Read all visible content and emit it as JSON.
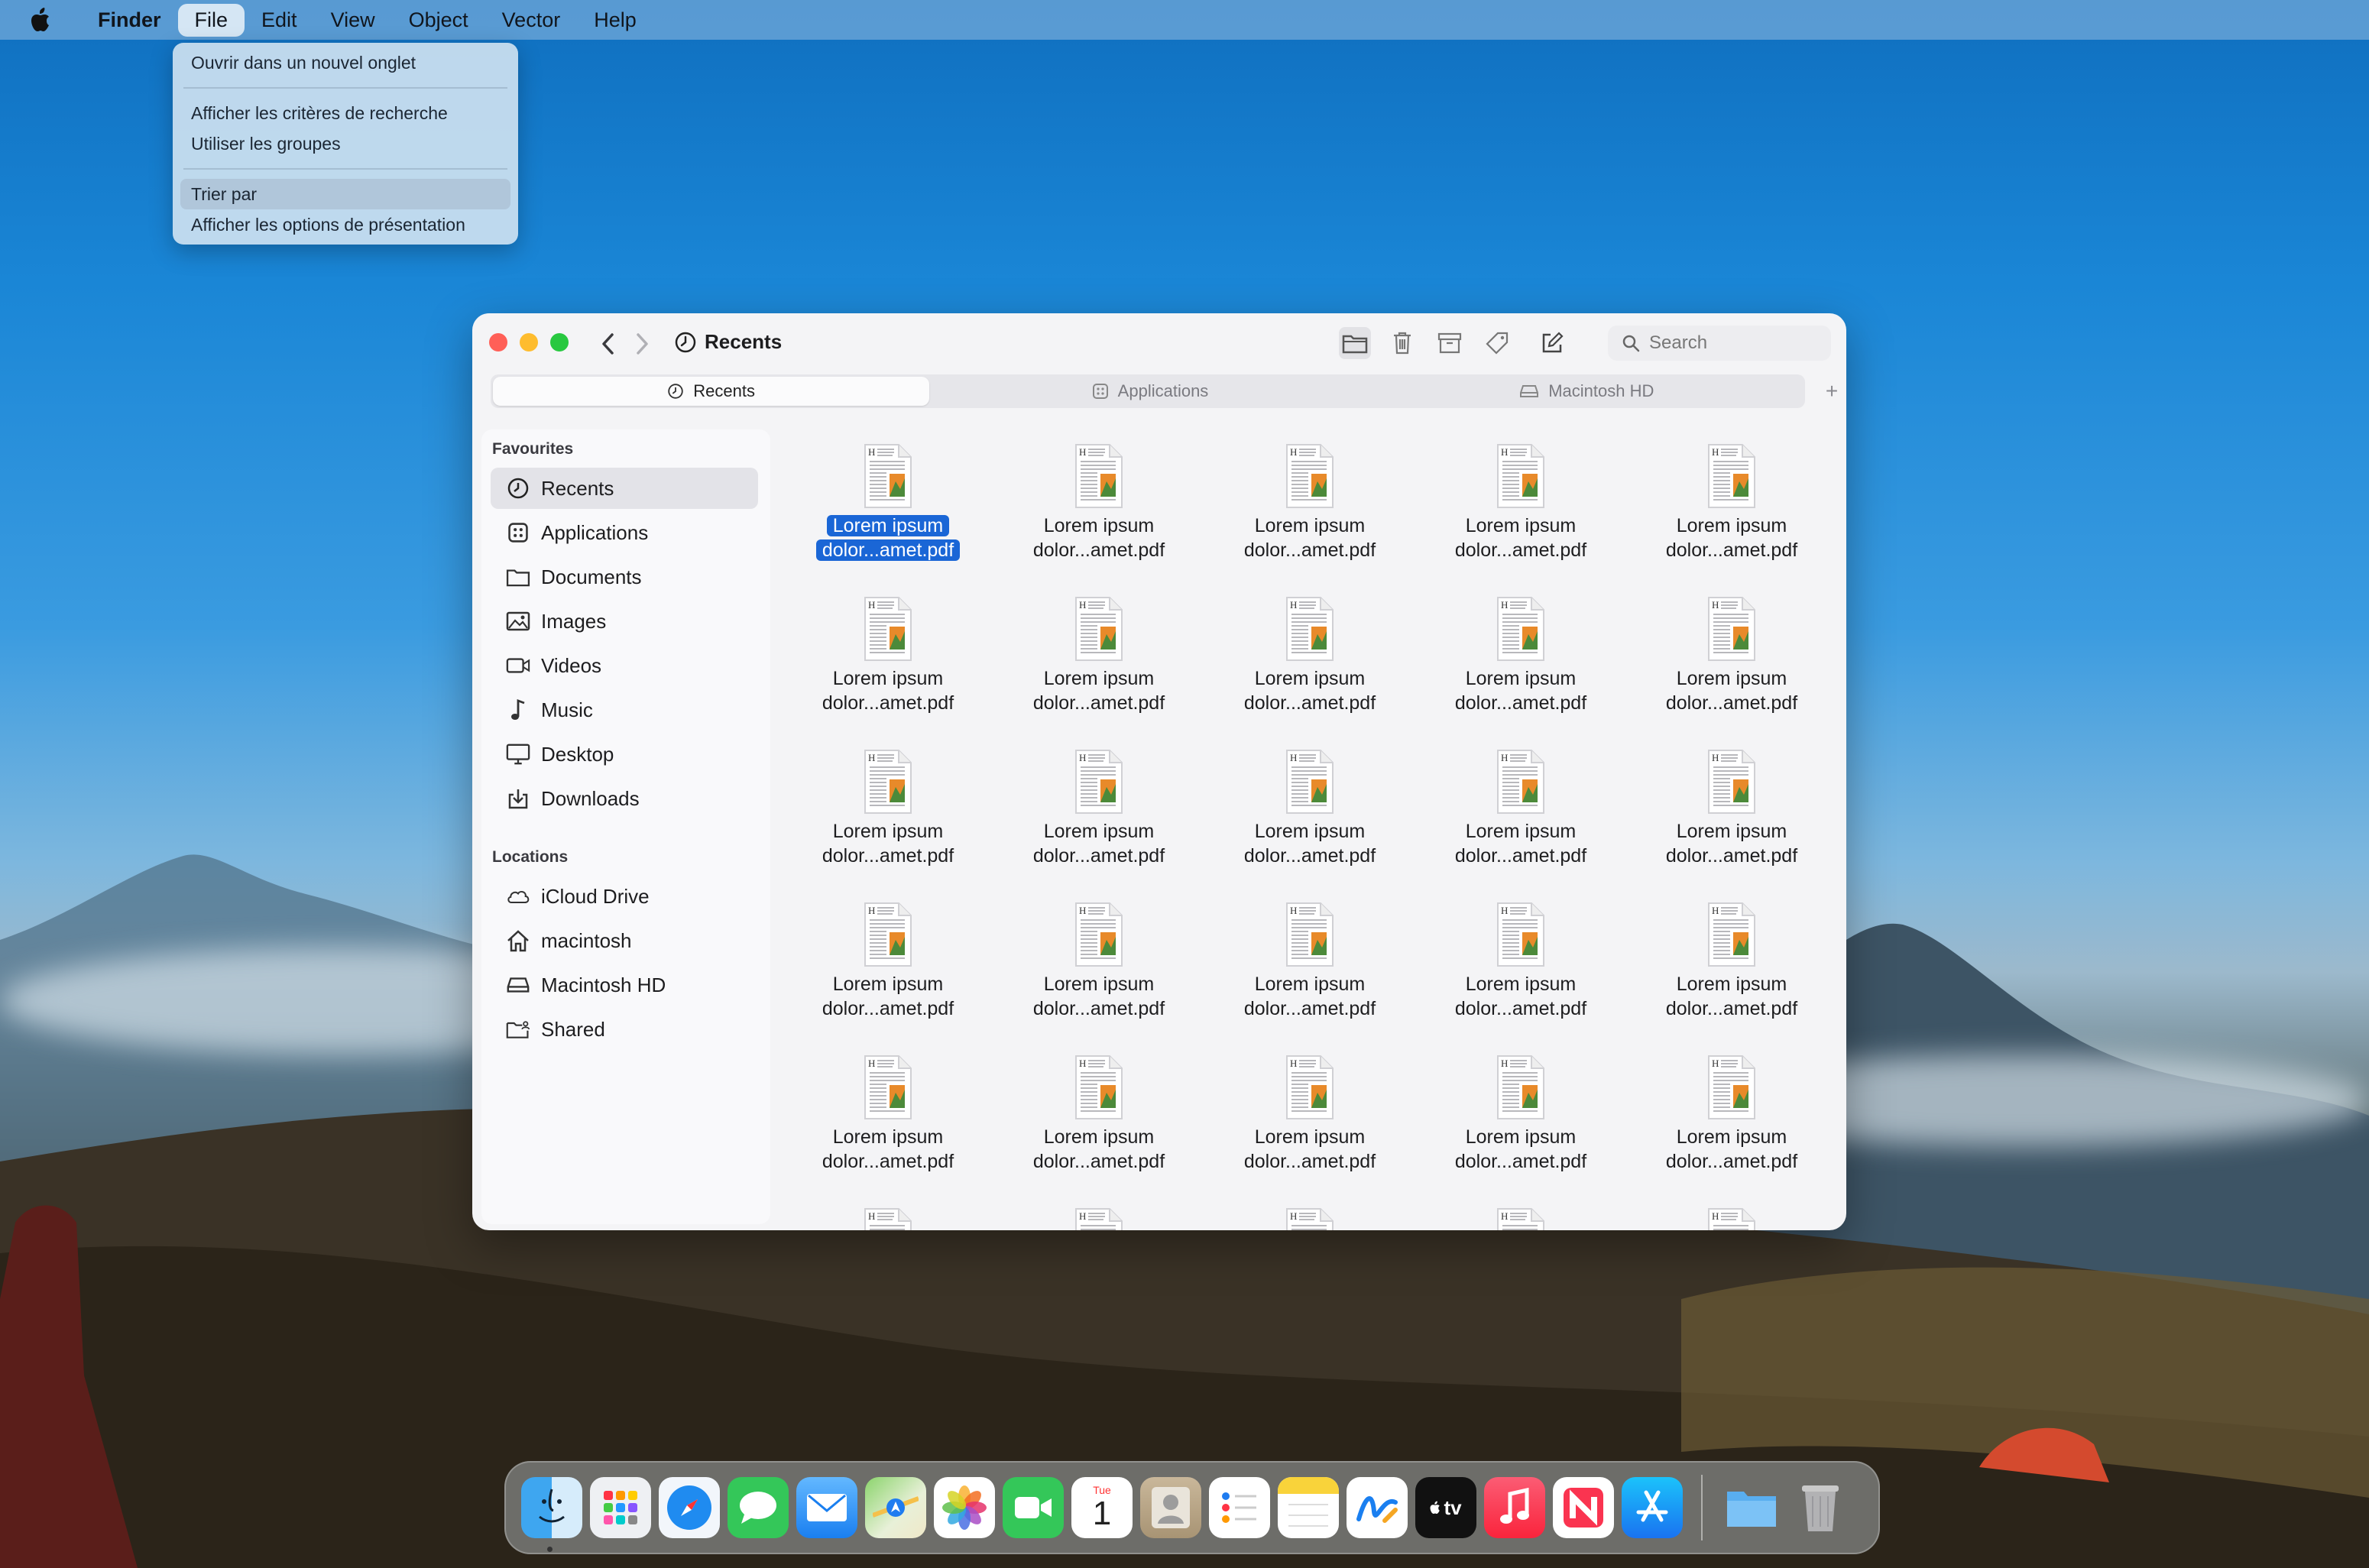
{
  "menubar": {
    "app_name": "Finder",
    "items": [
      "File",
      "Edit",
      "View",
      "Object",
      "Vector",
      "Help"
    ]
  },
  "file_menu": {
    "items": [
      "Ouvrir dans un nouvel onglet",
      "Afficher les critères de recherche",
      "Utiliser les groupes",
      "Trier par",
      "Afficher les options de présentation"
    ],
    "highlighted": "Trier par"
  },
  "window": {
    "title": "Recents",
    "search_placeholder": "Search",
    "tabs": [
      "Recents",
      "Applications",
      "Macintosh HD"
    ],
    "active_tab": "Recents",
    "add_tab": "+"
  },
  "sidebar": {
    "favourites_heading": "Favourites",
    "favourites": [
      "Recents",
      "Applications",
      "Documents",
      "Images",
      "Videos",
      "Music",
      "Desktop",
      "Downloads"
    ],
    "locations_heading": "Locations",
    "locations": [
      "iCloud Drive",
      "macintosh",
      "Macintosh HD",
      "Shared"
    ],
    "selected": "Recents"
  },
  "files": {
    "line1": "Lorem ipsum",
    "line2": "dolor...amet.pdf",
    "columns": 5,
    "full_rows": 5,
    "selected_index": 0
  },
  "dock": {
    "apps": [
      "finder",
      "launchpad",
      "safari",
      "messages",
      "mail",
      "maps",
      "photos",
      "facetime",
      "calendar",
      "contacts",
      "reminders",
      "notes",
      "freeform",
      "tv",
      "music",
      "news",
      "app-store"
    ],
    "calendar_day": "Tue",
    "calendar_date": "1",
    "tv_label": "tv",
    "trailing": [
      "downloads-folder",
      "trash"
    ]
  },
  "colors": {
    "accent": "#1a66d6",
    "close": "#ff5f57",
    "minimize": "#febc2e",
    "zoom": "#28c840"
  }
}
